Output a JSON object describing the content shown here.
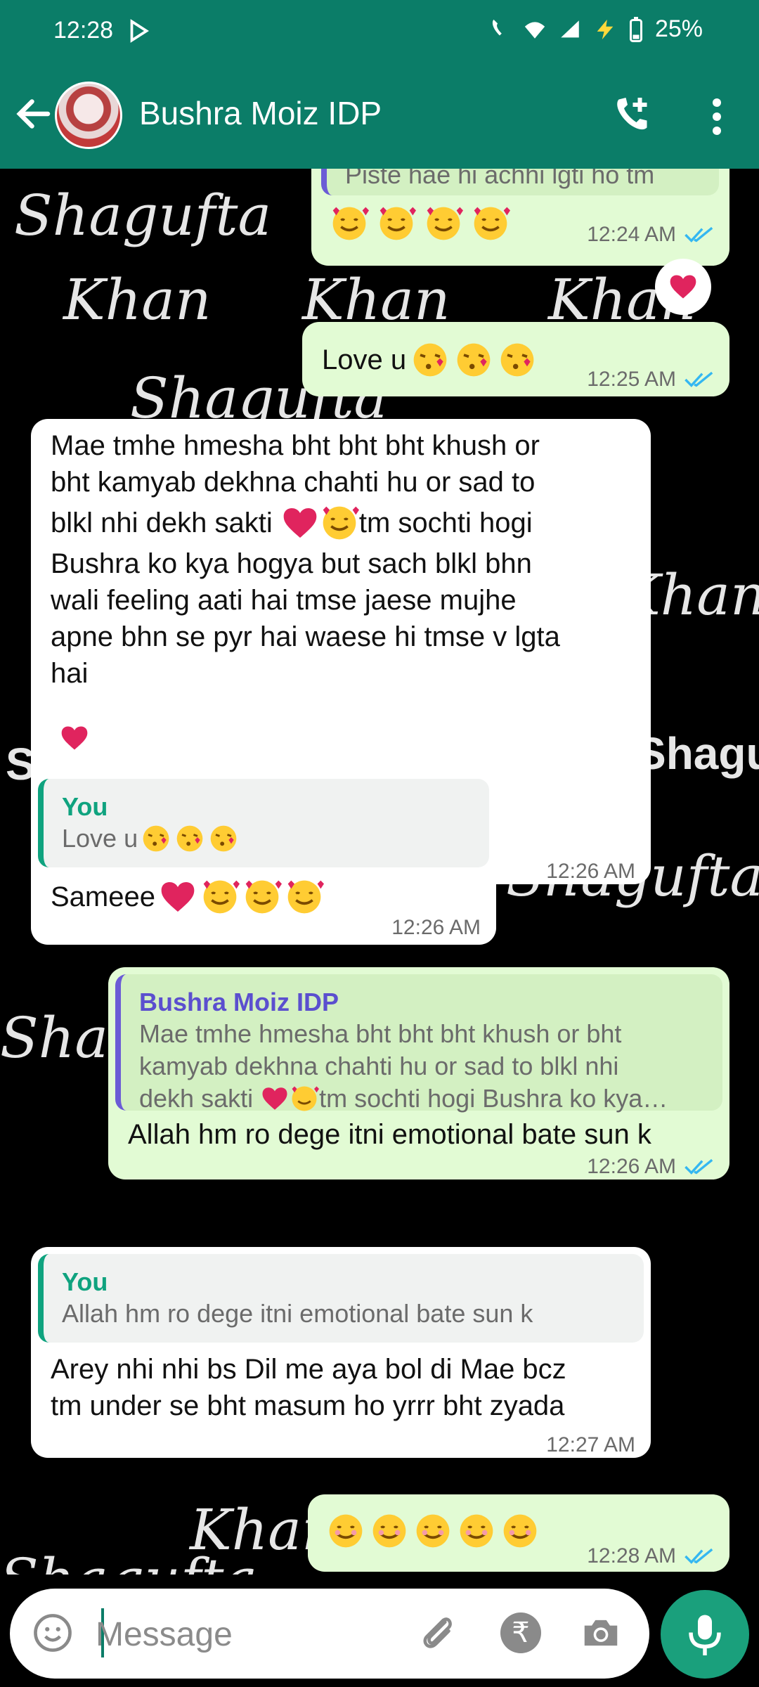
{
  "status": {
    "time": "12:28",
    "battery": "25%"
  },
  "header": {
    "contact_name": "Bushra Moiz IDP"
  },
  "watermark": {
    "w1": "Shagufta",
    "w2": "Khan",
    "w3": "Shagufta Khan",
    "w4": "Shagu"
  },
  "messages": [
    {
      "id": "m0",
      "type": "out",
      "partial_text": "Piste hae hi achhi lgti ho tm",
      "time": "12:24 AM"
    },
    {
      "id": "m1",
      "type": "out",
      "text": "Love u",
      "time": "12:25 AM"
    },
    {
      "id": "m2",
      "type": "in",
      "lines": [
        "Mae tmhe hmesha bht bht bht khush or",
        "bht kamyab dekhna chahti hu or sad to",
        "blkl nhi dekh sakti ",
        "tm sochti hogi",
        "Bushra ko kya hogya but sach blkl bhn",
        "wali feeling aati hai tmse jaese mujhe",
        "apne bhn se pyr hai waese hi tmse v lgta",
        "hai"
      ],
      "time": "12:26 AM"
    },
    {
      "id": "m3",
      "type": "in",
      "quote_author": "You",
      "quote_text": "Love u",
      "text": "Sameee",
      "time": "12:26 AM"
    },
    {
      "id": "m4",
      "type": "out",
      "quote_author": "Bushra Moiz IDP",
      "quote_lines": [
        "Mae tmhe hmesha bht bht bht khush or bht",
        "kamyab dekhna chahti hu or sad to blkl nhi",
        "dekh sakti ",
        "tm sochti hogi Bushra ko kya…"
      ],
      "text": "Allah hm ro dege itni emotional bate sun k",
      "time": "12:26 AM"
    },
    {
      "id": "m5",
      "type": "in",
      "quote_author": "You",
      "quote_text": "Allah hm ro dege itni emotional bate sun k",
      "lines": [
        "Arey nhi nhi bs Dil me aya bol di Mae bcz",
        "tm under se bht masum ho yrrr bht zyada"
      ],
      "time": "12:27 AM"
    },
    {
      "id": "m6",
      "type": "out",
      "time": "12:28 AM"
    }
  ],
  "input": {
    "placeholder": "Message"
  },
  "colors": {
    "header": "#0b7d68",
    "outgoing": "#e2fbd4",
    "incoming": "#ffffff",
    "tick_blue": "#34b7f1",
    "mic": "#1aa07c"
  }
}
